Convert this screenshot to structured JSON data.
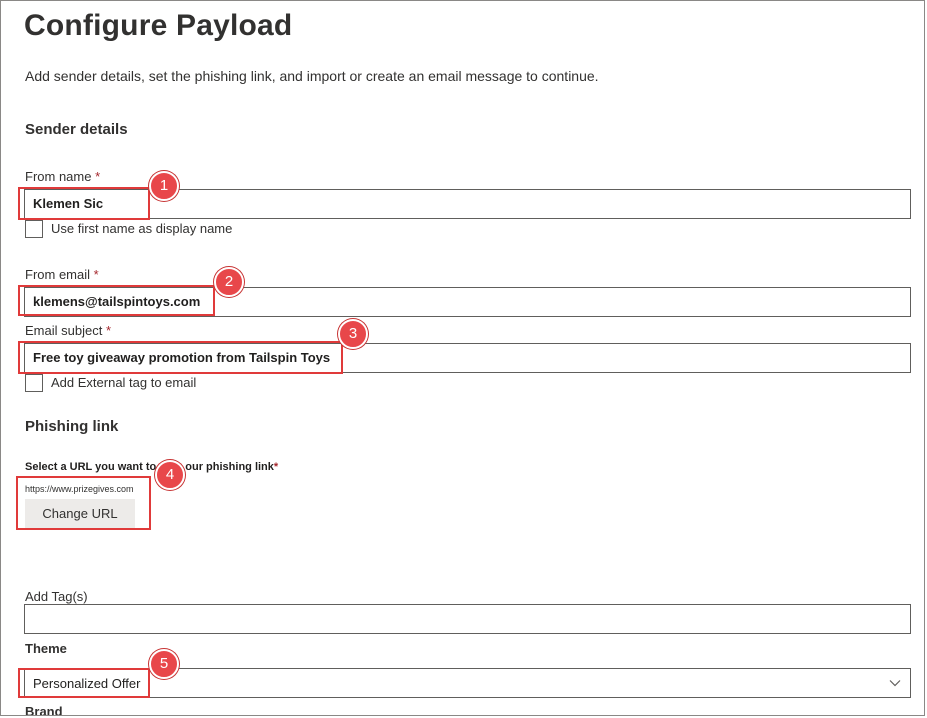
{
  "page": {
    "title": "Configure Payload",
    "description": "Add sender details, set the phishing link, and import or create an email message to continue."
  },
  "sender_details": {
    "heading": "Sender details",
    "from_name": {
      "label": "From name",
      "required_mark": "*",
      "value": "Klemen Sic"
    },
    "use_first_name_checkbox": {
      "label": "Use first name as display name",
      "checked": false
    },
    "from_email": {
      "label": "From email",
      "required_mark": "*",
      "value": "klemens@tailspintoys.com"
    },
    "email_subject": {
      "label": "Email subject",
      "required_mark": "*",
      "value": "Free toy giveaway promotion from Tailspin Toys"
    },
    "external_tag_checkbox": {
      "label": "Add External tag to email",
      "checked": false
    }
  },
  "phishing_link": {
    "heading": "Phishing link",
    "select_label_start": "Select a URL you want to ",
    "select_label_end": "our phishing link",
    "required_mark": "*",
    "url": "https://www.prizegives.com",
    "change_button": "Change URL"
  },
  "tags": {
    "label": "Add Tag(s)",
    "value": ""
  },
  "theme": {
    "label": "Theme",
    "value": "Personalized Offer"
  },
  "brand": {
    "label": "Brand"
  },
  "callouts": [
    "1",
    "2",
    "3",
    "4",
    "5"
  ],
  "colors": {
    "highlight": "#e03a3a",
    "badge": "#e8474a",
    "required": "#a4262c"
  }
}
